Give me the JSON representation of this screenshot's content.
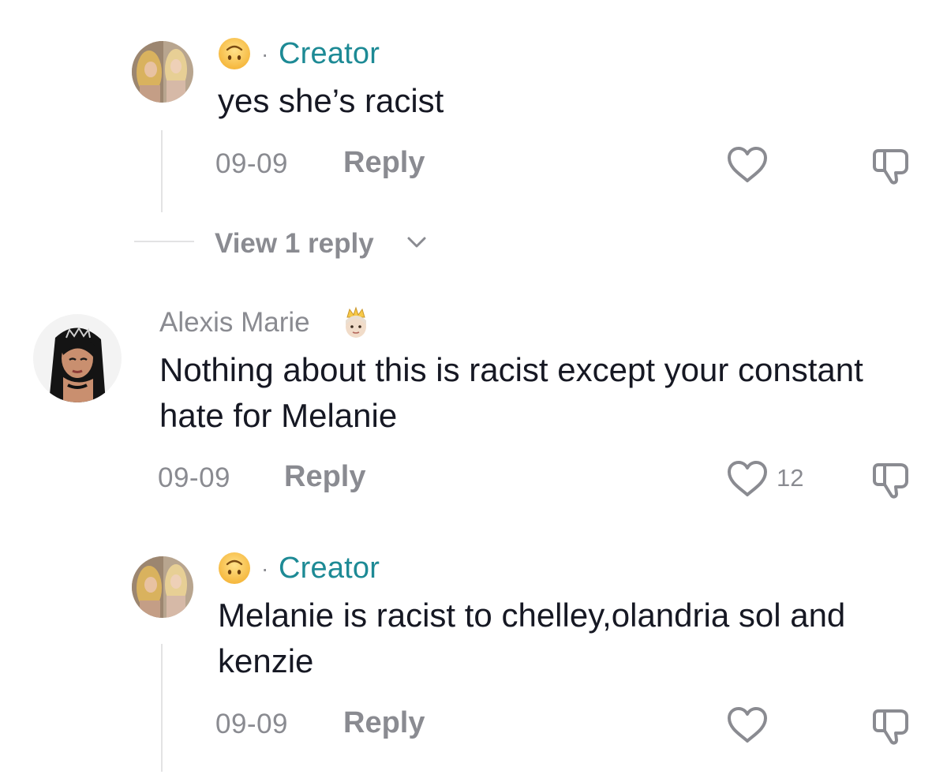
{
  "comments": [
    {
      "type": "reply",
      "author_badge": "Creator",
      "separator": "·",
      "text": "yes she’s racist",
      "date": "09-09",
      "reply_label": "Reply",
      "likes": ""
    },
    {
      "type": "top",
      "author": "Alexis Marie",
      "author_emoji": "princess-emoji",
      "text": "Nothing about this is racist except your constant hate for Melanie",
      "date": "09-09",
      "reply_label": "Reply",
      "likes": "12"
    },
    {
      "type": "reply",
      "author_badge": "Creator",
      "separator": "·",
      "text": "Melanie is racist to chelley,olandria sol and kenzie",
      "date": "09-09",
      "reply_label": "Reply",
      "likes": ""
    }
  ],
  "view_replies_label": "View 1 reply",
  "colors": {
    "creator": "#1d8a95",
    "muted": "#8a8b91",
    "text": "#161823",
    "divider": "#e3e3e4"
  },
  "icons": [
    "upside-down-face-emoji",
    "heart-outline-icon",
    "dislike-icon",
    "chevron-down-icon"
  ]
}
